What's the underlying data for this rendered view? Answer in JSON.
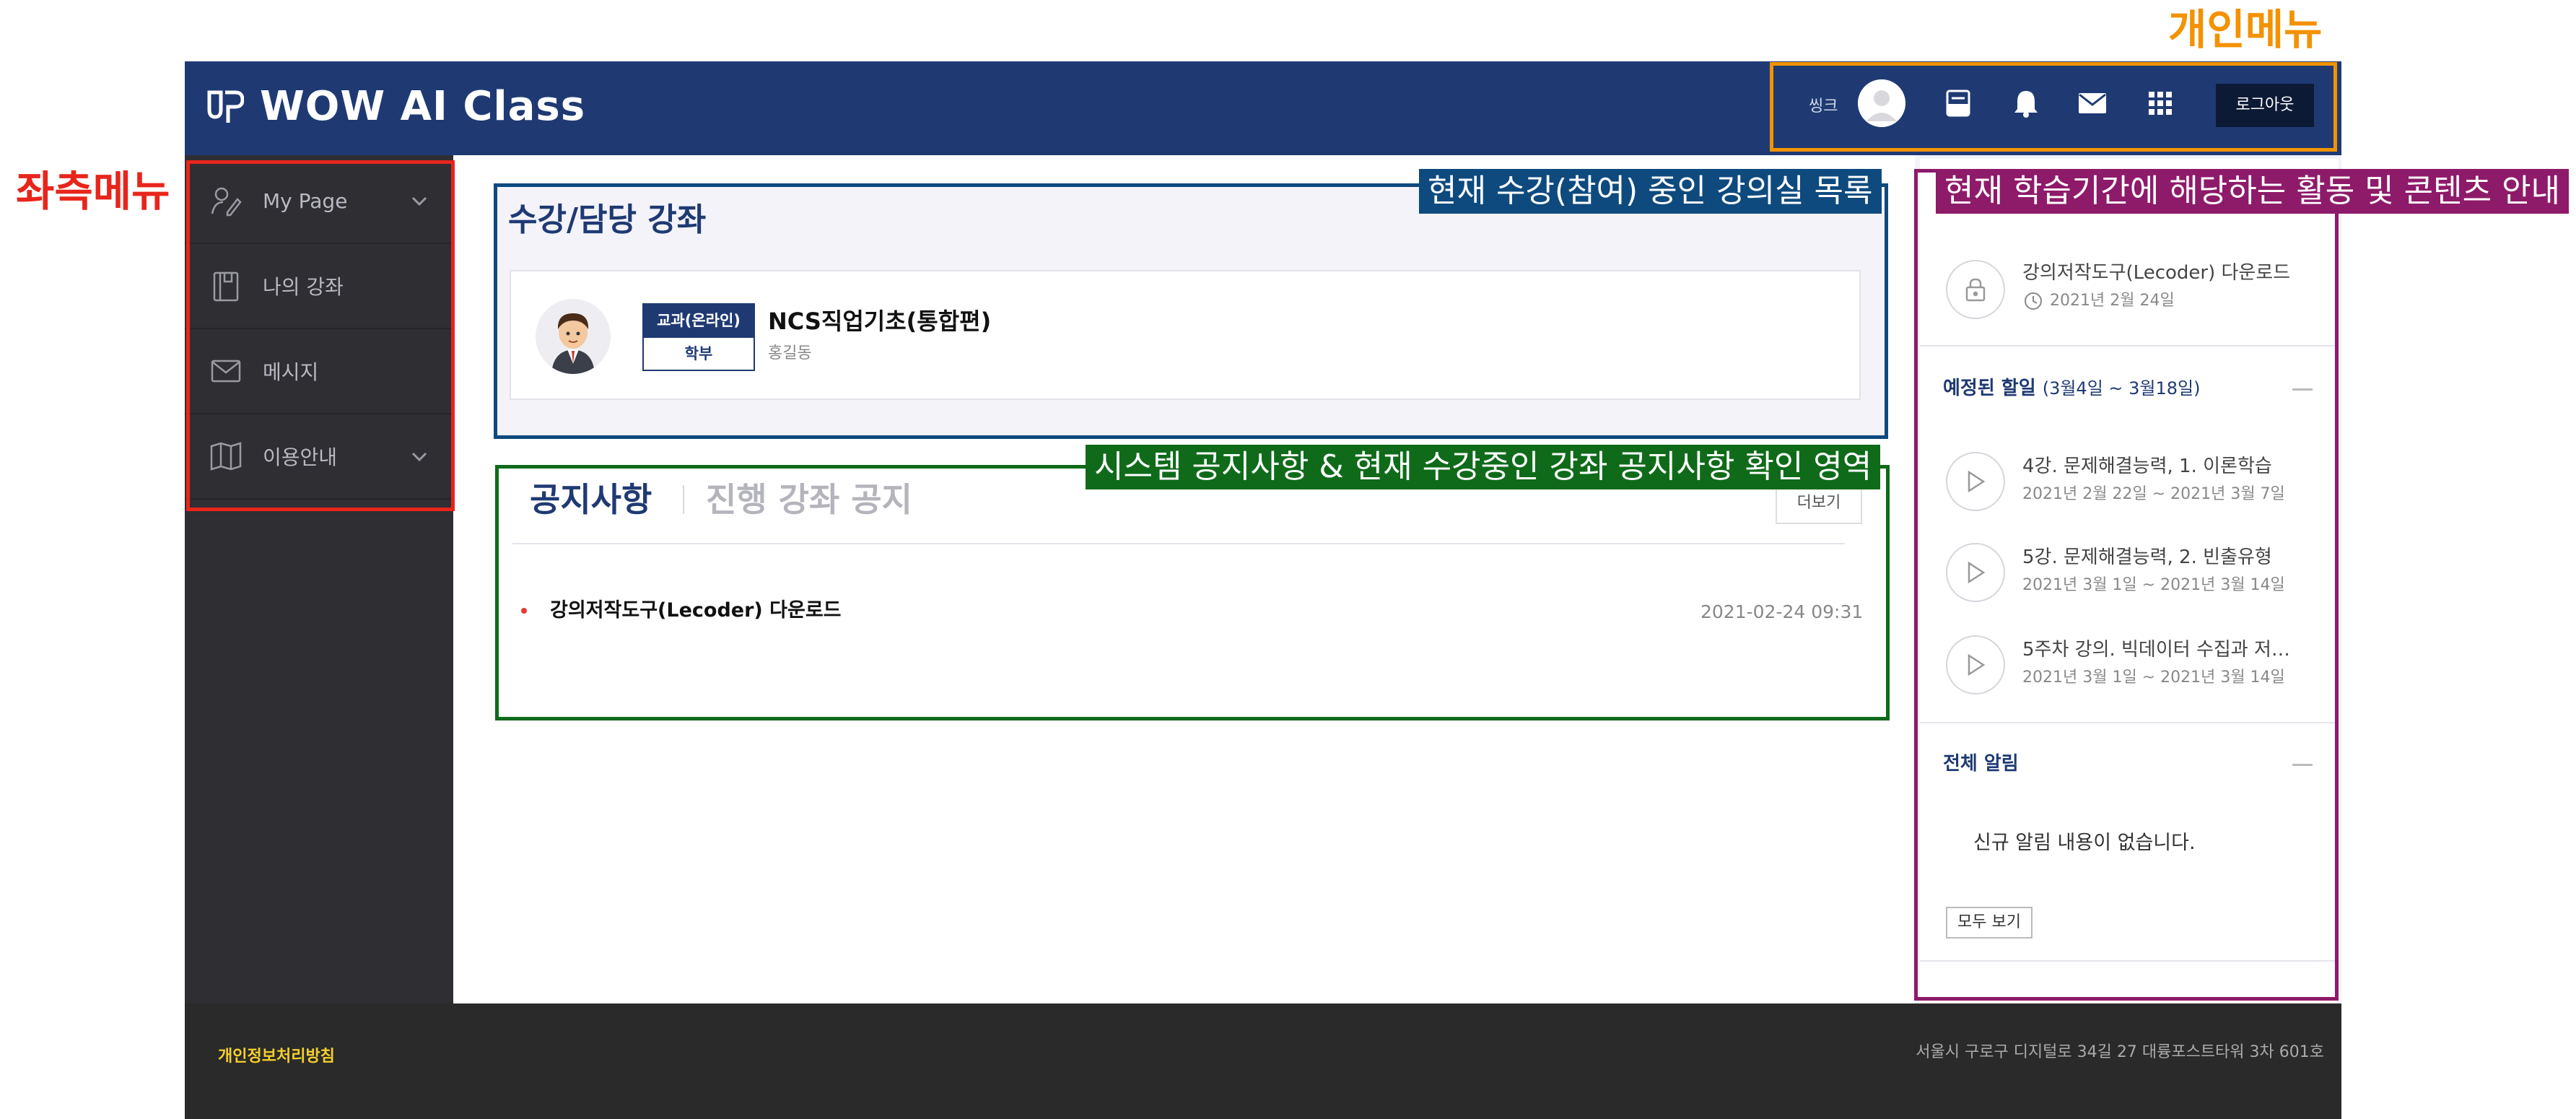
{
  "header": {
    "logo_text": "WOW AI Class",
    "user_name": "씽크",
    "logout_label": "로그아웃",
    "icons": [
      "layout-icon",
      "bell-icon",
      "mail-icon",
      "apps-grid-icon"
    ]
  },
  "sidebar": {
    "items": [
      {
        "label": "My Page",
        "icon": "user-pen-icon",
        "expandable": true
      },
      {
        "label": "나의 강좌",
        "icon": "book-icon",
        "expandable": false
      },
      {
        "label": "메시지",
        "icon": "envelope-icon",
        "expandable": false
      },
      {
        "label": "이용안내",
        "icon": "map-icon",
        "expandable": true
      }
    ]
  },
  "courses": {
    "heading": "수강/담당 강좌",
    "items": [
      {
        "tag_type": "교과(온라인)",
        "tag_level": "학부",
        "title": "NCS직업기초(통합편)",
        "professor": "홍길동"
      }
    ]
  },
  "notices": {
    "tab_active": "공지사항",
    "tab_inactive": "진행 강좌 공지",
    "more_label": "더보기",
    "items": [
      {
        "title": "강의저작도구(Lecoder) 다운로드",
        "date": "2021-02-24 09:31"
      }
    ]
  },
  "right_panel": {
    "top_item": {
      "title": "강의저작도구(Lecoder) 다운로드",
      "date": "2021년 2월 24일"
    },
    "todo": {
      "title": "예정된 할일",
      "range": "(3월4일 ~ 3월18일)",
      "items": [
        {
          "title": "4강. 문제해결능력, 1. 이론학습",
          "date": "2021년 2월 22일 ~ 2021년 3월 7일"
        },
        {
          "title": "5강. 문제해결능력, 2. 빈출유형",
          "date": "2021년 3월 1일 ~ 2021년 3월 14일"
        },
        {
          "title": "5주차 강의. 빅데이터 수집과 저…",
          "date": "2021년 3월 1일 ~ 2021년 3월 14일"
        }
      ]
    },
    "alerts": {
      "title": "전체 알림",
      "empty_text": "신규 알림 내용이 없습니다.",
      "view_all_label": "모두 보기"
    }
  },
  "footer": {
    "privacy_label": "개인정보처리방침",
    "address": "서울시 구로구 디지털로 34길 27 대륭포스트타워 3차 601호"
  },
  "annotations": {
    "personal_menu": "개인메뉴",
    "left_menu": "좌측메뉴",
    "course_list": "현재 수강(참여) 중인 강의실 목록",
    "notice_area": "시스템 공지사항 & 현재 수강중인 강좌 공지사항 확인 영역",
    "activity_area": "현재 학습기간에 해당하는 활동 및 콘텐츠 안내"
  },
  "colors": {
    "header_bg": "#1f3a73",
    "sidebar_bg": "#2e2e33",
    "accent_navy": "#1f3a73",
    "annotation_orange": "#f39200",
    "annotation_red": "#e8251c",
    "annotation_blue": "#0e4a7e",
    "annotation_green": "#0f6b1a",
    "annotation_purple": "#8e1a6a",
    "footer_bg": "#2a2a2a",
    "footer_link": "#f5d02c"
  }
}
